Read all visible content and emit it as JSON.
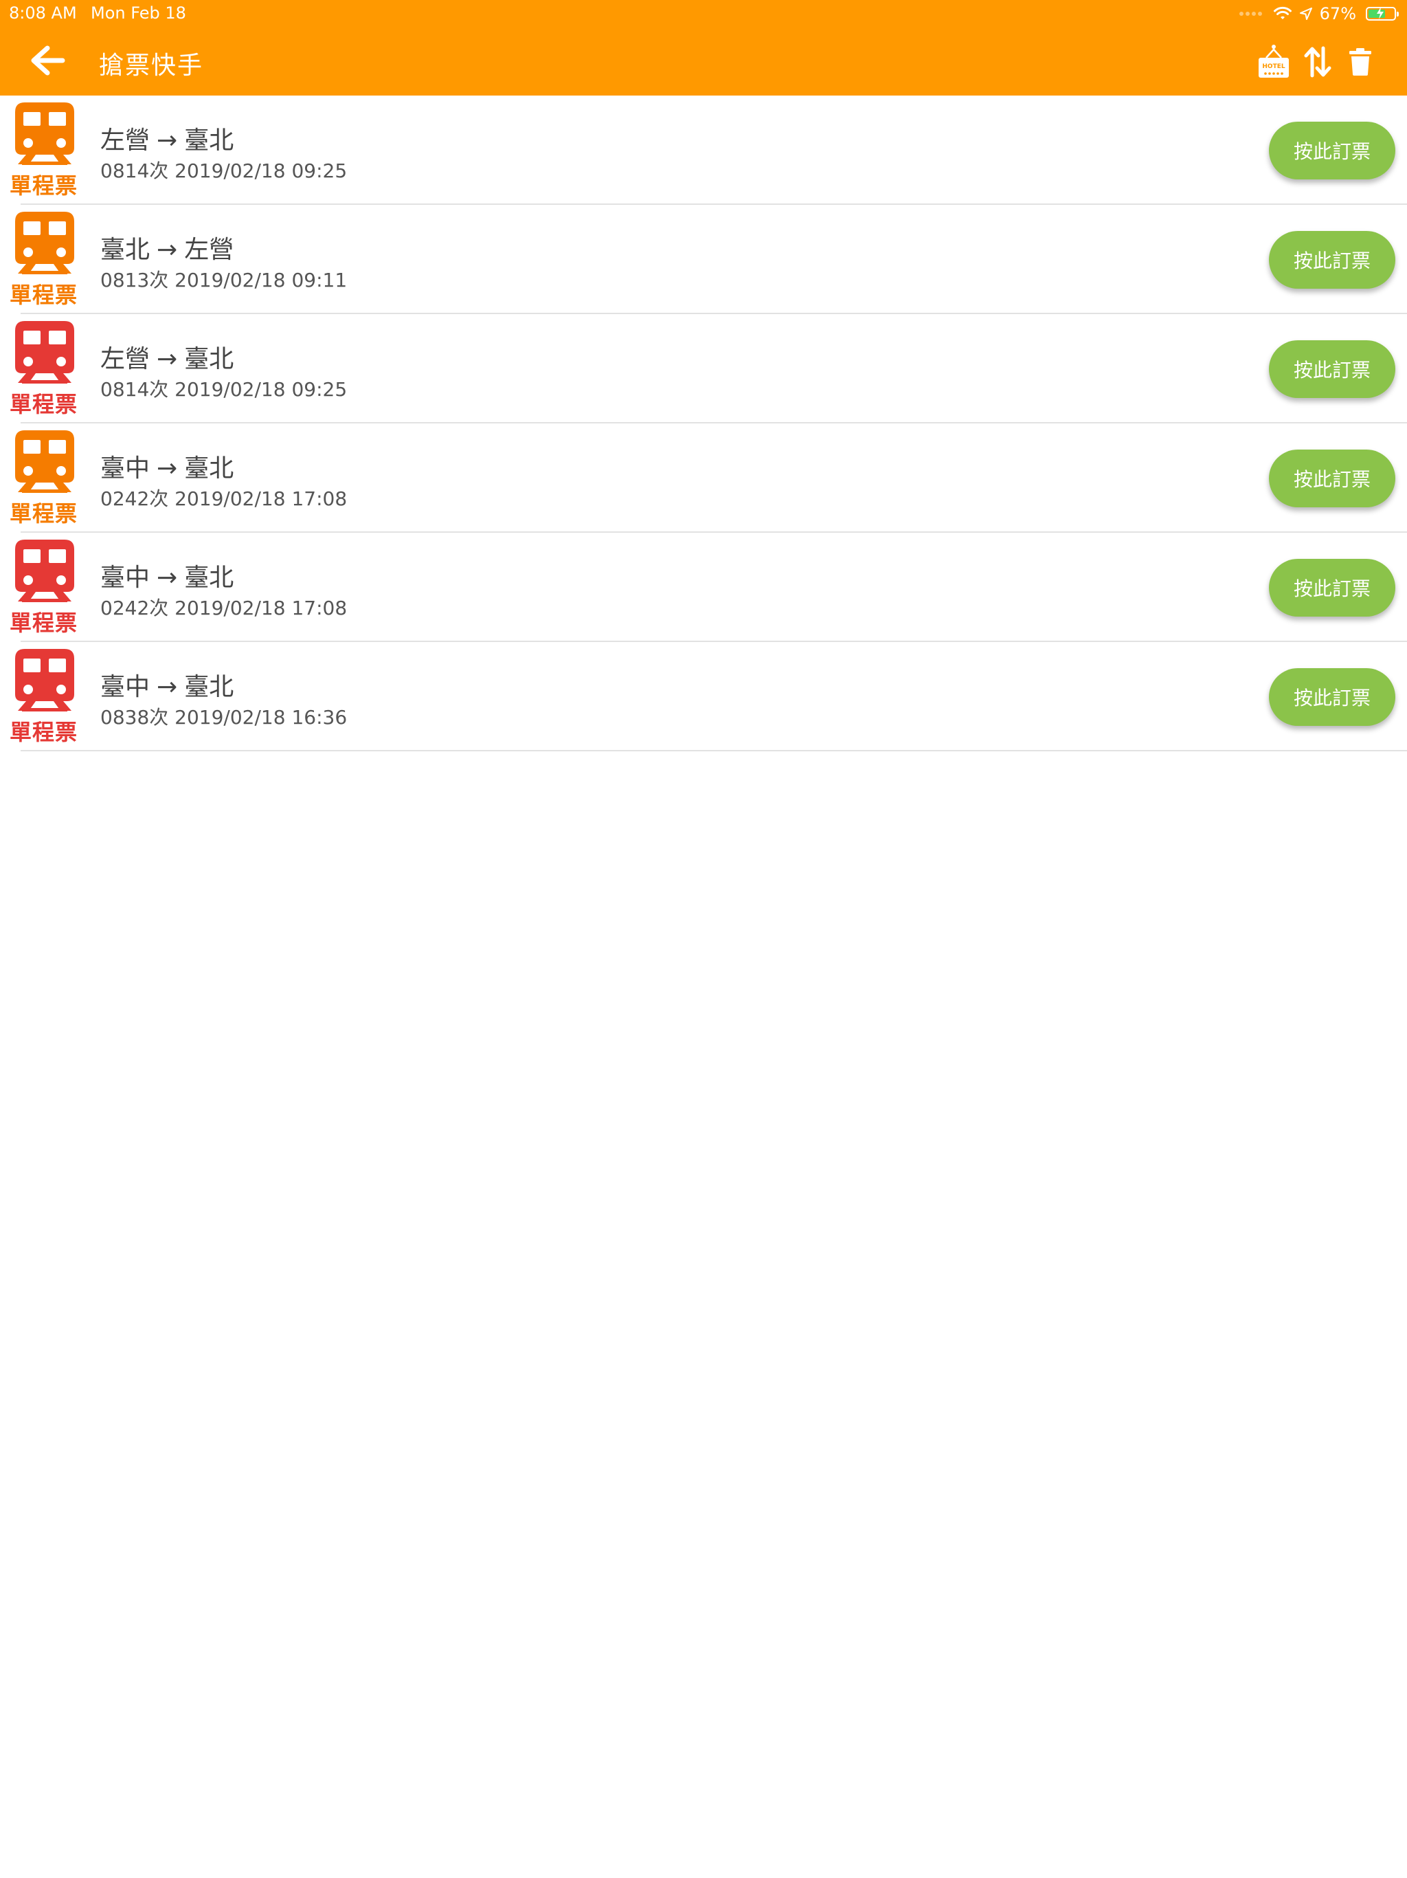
{
  "status_bar": {
    "time": "8:08 AM",
    "date": "Mon Feb 18",
    "battery_percent": "67%",
    "battery_level": 0.67,
    "icons": [
      "signal-dots-icon",
      "wifi-icon",
      "location-arrow-icon",
      "battery-charging-icon"
    ]
  },
  "app_bar": {
    "title": "搶票快手",
    "back_icon": "arrow-left-icon",
    "actions": [
      "hotel-sign-icon",
      "sort-up-down-icon",
      "trash-icon"
    ]
  },
  "colors": {
    "app_bar": "#FF9900",
    "train_orange": "#F57C00",
    "train_red": "#E53935",
    "book_button": "#8BC34A",
    "divider": "#E2E2E2"
  },
  "tickets": [
    {
      "type": "單程票",
      "color": "orange",
      "from": "左營",
      "arrow": "→",
      "to": "臺北",
      "detail": "0814次 2019/02/18 09:25",
      "button": "按此訂票"
    },
    {
      "type": "單程票",
      "color": "orange",
      "from": "臺北",
      "arrow": "→",
      "to": "左營",
      "detail": "0813次 2019/02/18 09:11",
      "button": "按此訂票"
    },
    {
      "type": "單程票",
      "color": "red",
      "from": "左營",
      "arrow": "→",
      "to": "臺北",
      "detail": "0814次 2019/02/18 09:25",
      "button": "按此訂票"
    },
    {
      "type": "單程票",
      "color": "orange",
      "from": "臺中",
      "arrow": "→",
      "to": "臺北",
      "detail": "0242次 2019/02/18 17:08",
      "button": "按此訂票"
    },
    {
      "type": "單程票",
      "color": "red",
      "from": "臺中",
      "arrow": "→",
      "to": "臺北",
      "detail": "0242次 2019/02/18 17:08",
      "button": "按此訂票"
    },
    {
      "type": "單程票",
      "color": "red",
      "from": "臺中",
      "arrow": "→",
      "to": "臺北",
      "detail": "0838次 2019/02/18 16:36",
      "button": "按此訂票"
    }
  ]
}
